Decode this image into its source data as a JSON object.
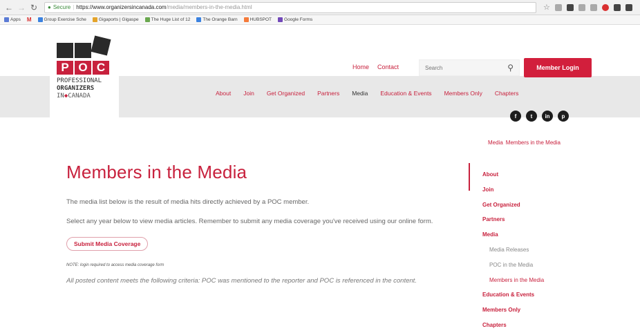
{
  "browser": {
    "url_secure": "Secure",
    "url_host": "https://www.organizersincanada.com",
    "url_path": "/media/members-in-the-media.html",
    "bookmarks": [
      {
        "label": "Apps"
      },
      {
        "label": "M"
      },
      {
        "label": "Group Exercise Sche"
      },
      {
        "label": "Gigaports | Gigaspe"
      },
      {
        "label": "The Huge List of 12"
      },
      {
        "label": "The Orange Barn"
      },
      {
        "label": "HUBSPOT"
      },
      {
        "label": "Google Forms"
      }
    ]
  },
  "logo": {
    "letters": [
      "P",
      "O",
      "C"
    ],
    "line1": "PROFESSIONAL",
    "line2": "ORGANIZERS",
    "line3_a": "IN",
    "line3_b": "CANADA"
  },
  "header": {
    "home": "Home",
    "contact": "Contact",
    "search_placeholder": "Search",
    "login": "Member Login"
  },
  "nav": {
    "items": [
      "About",
      "Join",
      "Get Organized",
      "Partners",
      "Media",
      "Education & Events",
      "Members Only",
      "Chapters"
    ]
  },
  "social": [
    "f",
    "t",
    "in",
    "p"
  ],
  "breadcrumb": {
    "parent": "Media",
    "current": "Members in the Media"
  },
  "main": {
    "title": "Members in the Media",
    "para1": "The media list below is the result of media hits directly achieved by a POC member.",
    "para2": "Select any year below to view media articles. Remember to submit any media coverage you've received using our online form.",
    "submit": "Submit Media Coverage",
    "note": "NOTE: login required to access media coverage form",
    "criteria": "All posted content meets the following criteria: POC was mentioned to the reporter and POC is referenced in the content."
  },
  "sidebar": {
    "about": "About",
    "join": "Join",
    "get_organized": "Get Organized",
    "partners": "Partners",
    "media": "Media",
    "media_releases": "Media Releases",
    "poc_in_media": "POC in the Media",
    "members_in_media": "Members in the Media",
    "education": "Education & Events",
    "members_only": "Members Only",
    "chapters": "Chapters"
  }
}
